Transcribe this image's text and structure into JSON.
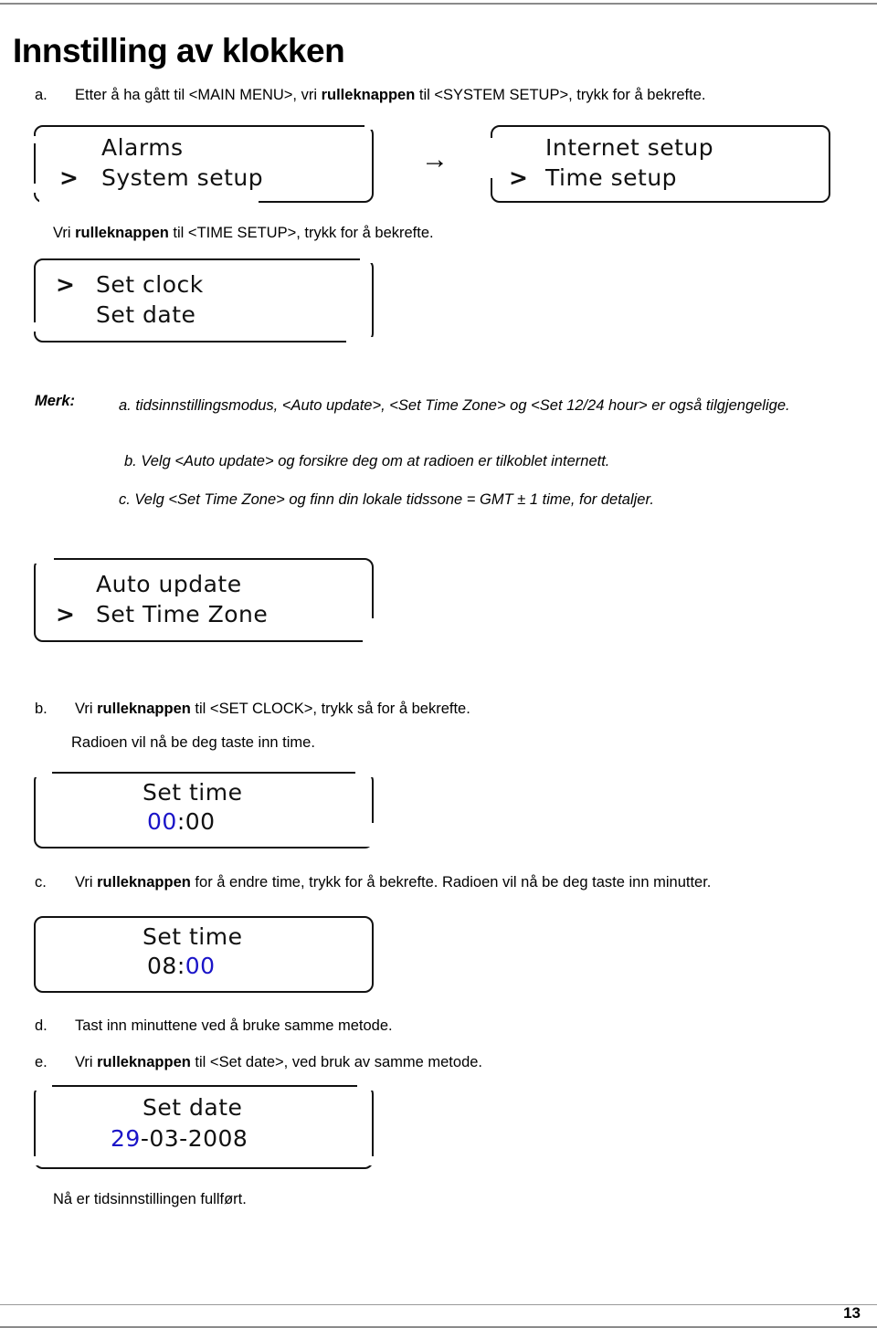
{
  "document": {
    "title": "Innstilling av klokken",
    "page_number": "13",
    "language": "Norwegian"
  },
  "steps": {
    "a": {
      "marker": "a.",
      "text_1": "Etter å ha gått til <MAIN MENU>, vri ",
      "bold_1": "rulleknappen",
      "text_2": " til <SYSTEM SETUP>, trykk for å bekrefte."
    },
    "a_sub": {
      "text_1": "Vri ",
      "bold_1": "rulleknappen",
      "text_2": " til <TIME SETUP>, trykk for å bekrefte."
    },
    "b": {
      "marker": "b.",
      "text_1": "Vri ",
      "bold_1": "rulleknappen",
      "text_2": " til <SET CLOCK>, trykk så for å bekrefte.",
      "sub_text": "Radioen vil nå be deg taste inn time."
    },
    "c": {
      "marker": "c.",
      "text_1": "Vri ",
      "bold_1": "rulleknappen",
      "text_2": " for å endre time, trykk for å bekrefte. Radioen vil nå be deg taste inn minutter."
    },
    "d": {
      "marker": "d.",
      "text_1": "Tast inn minuttene ved å bruke samme metode."
    },
    "e": {
      "marker": "e.",
      "text_1": "Vri ",
      "bold_1": "rulleknappen",
      "text_2": " til <Set date>, ved bruk av samme metode."
    },
    "final": {
      "text": "Nå er tidsinnstillingen fullført."
    }
  },
  "note": {
    "label": "Merk:",
    "item_a": "a. tidsinnstillingsmodus, <Auto update>, <Set Time Zone> og <Set 12/24 hour> er også tilgjengelige.",
    "item_b": "b. Velg <Auto update> og forsikre deg om at radioen er tilkoblet internett.",
    "item_c": "c. Velg <Set Time Zone> og finn din lokale tidssone = GMT ± 1 time, for detaljer."
  },
  "lcd_screens": {
    "main_menu": {
      "line1": "Alarms",
      "line2": "System setup",
      "cursor_on_line": 2,
      "cursor_glyph": ">"
    },
    "system_setup": {
      "line1": "Internet setup",
      "line2": "Time setup",
      "cursor_on_line": 2,
      "cursor_glyph": ">"
    },
    "time_setup": {
      "line1": "Set clock",
      "line2": "Set date",
      "cursor_on_line": 1,
      "cursor_glyph": ">"
    },
    "time_setup_more": {
      "line1": "Auto update",
      "line2": "Set Time Zone",
      "cursor_on_line": 2,
      "cursor_glyph": ">"
    },
    "set_time_hours": {
      "title": "Set time",
      "hours": "00",
      "separator": ":",
      "minutes": "00",
      "highlighted_field": "hours",
      "highlight_color": "#1a14c8"
    },
    "set_time_minutes": {
      "title": "Set time",
      "hours": "08",
      "separator": ":",
      "minutes": "00",
      "highlighted_field": "minutes",
      "highlight_color": "#1a14c8"
    },
    "set_date": {
      "title": "Set date",
      "day": "29",
      "sep1": "-",
      "month": "03",
      "sep2": "-",
      "year": "2008",
      "highlighted_field": "day",
      "highlight_color": "#1a14c8"
    }
  },
  "icons": {
    "flow_arrow": "→"
  }
}
